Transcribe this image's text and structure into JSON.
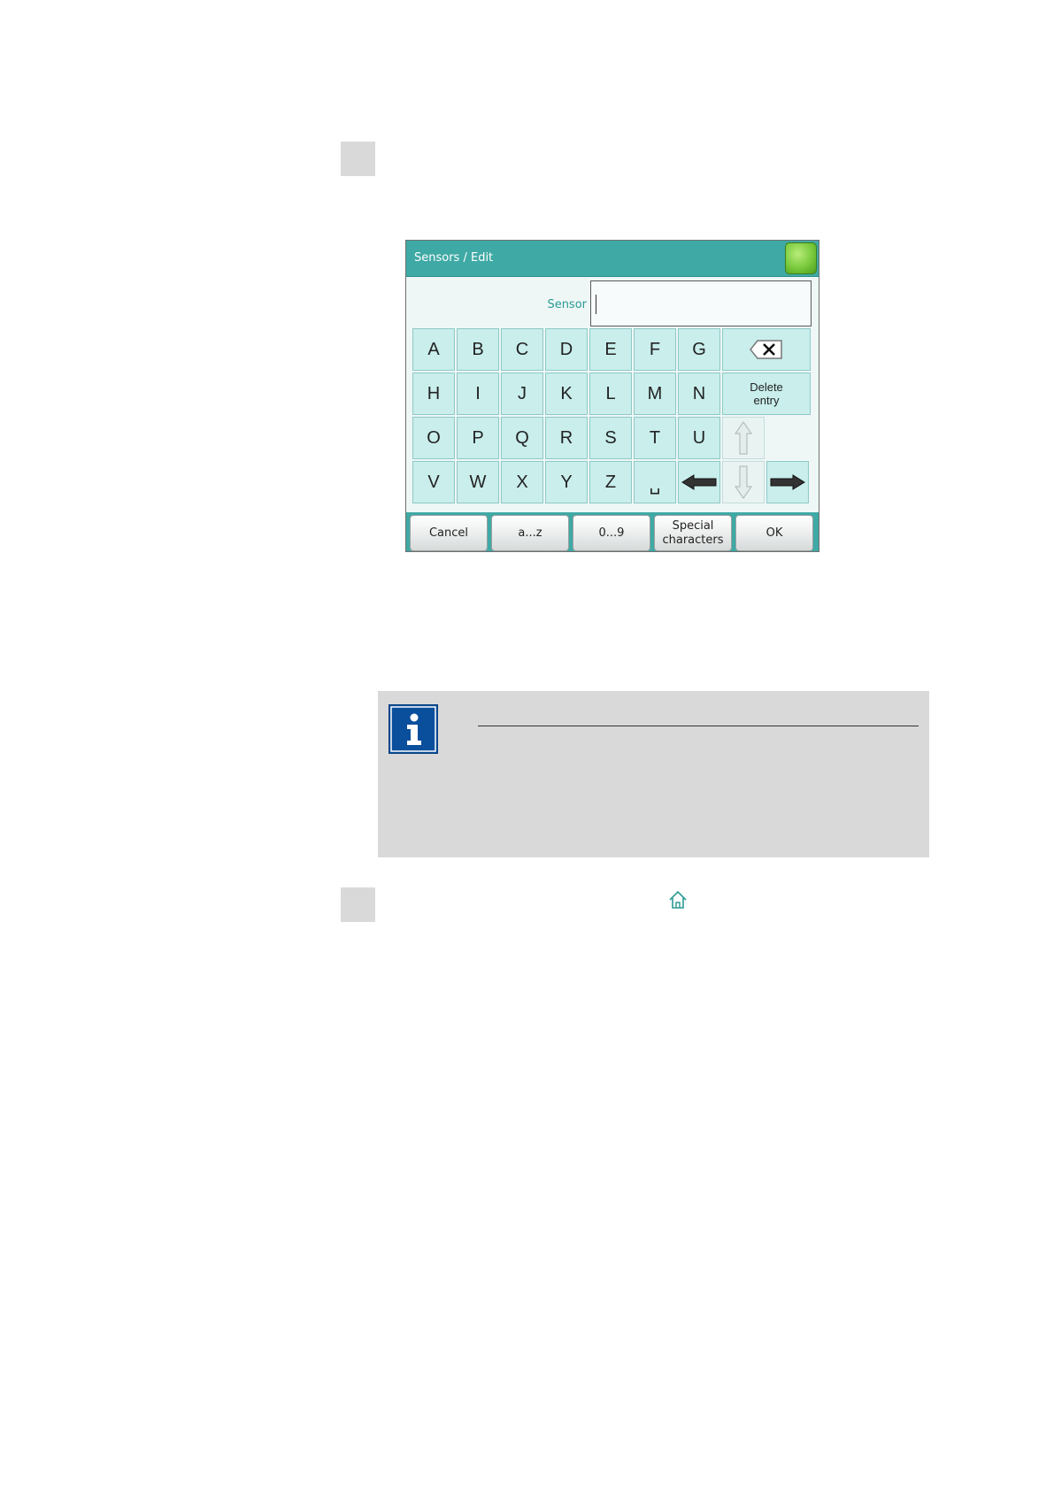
{
  "dialog": {
    "title": "Sensors / Edit",
    "field_label": "Sensor",
    "field_value": ""
  },
  "keyboard": {
    "row1": [
      "A",
      "B",
      "C",
      "D",
      "E",
      "F",
      "G"
    ],
    "row2": [
      "H",
      "I",
      "J",
      "K",
      "L",
      "M",
      "N"
    ],
    "row3": [
      "O",
      "P",
      "Q",
      "R",
      "S",
      "T",
      "U"
    ],
    "row4": [
      "V",
      "W",
      "X",
      "Y",
      "Z",
      "␣"
    ],
    "delete_entry": [
      "Delete",
      "entry"
    ]
  },
  "bottom_buttons": {
    "cancel": "Cancel",
    "lowercase": "a...z",
    "numbers": "0...9",
    "special": [
      "Special",
      "characters"
    ],
    "ok": "OK"
  },
  "colors": {
    "title_bar": "#3fa9a5",
    "key_face": "#c9eeec",
    "info_icon": "#0a4f9c",
    "home_button": "#79c93c"
  }
}
